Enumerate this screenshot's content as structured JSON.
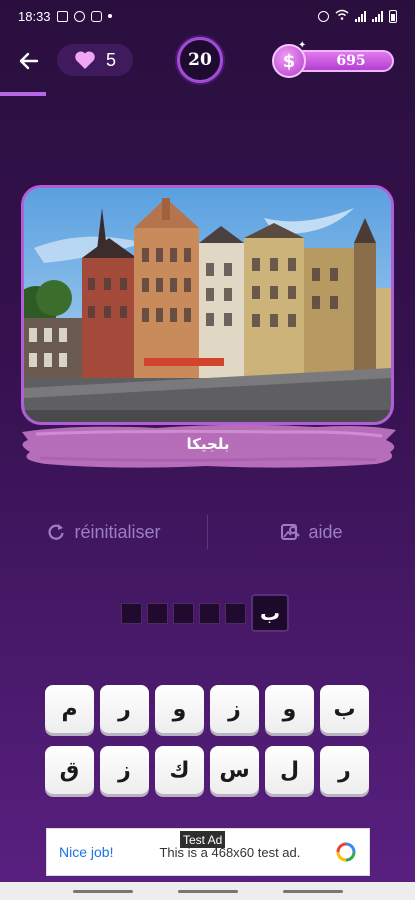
{
  "status_bar": {
    "time": "18:33",
    "icons": [
      "gallery-icon",
      "ball-icon",
      "instagram-icon",
      "alarm-icon",
      "wifi-icon",
      "signal-icon",
      "battery-icon"
    ]
  },
  "header": {
    "lives": "5",
    "level": "20",
    "coins": "695",
    "level_progress": 0.11
  },
  "puzzle": {
    "answer_text": "بلجيكا",
    "slots_total": 6,
    "revealed_letter": "ب"
  },
  "actions": {
    "reset_label": "réinitialiser",
    "help_label": "aide"
  },
  "keyboard": {
    "row1": [
      "م",
      "ر",
      "و",
      "ز",
      "و",
      "ب"
    ],
    "row2": [
      "ق",
      "ز",
      "ك",
      "س",
      "ل",
      "ر"
    ]
  },
  "ad": {
    "tag": "Test Ad",
    "headline": "Nice job!",
    "body": "This is a 468x60 test ad."
  },
  "colors": {
    "accent": "#b15fd6",
    "background": "#35114f",
    "coin": "#c04fd8"
  }
}
